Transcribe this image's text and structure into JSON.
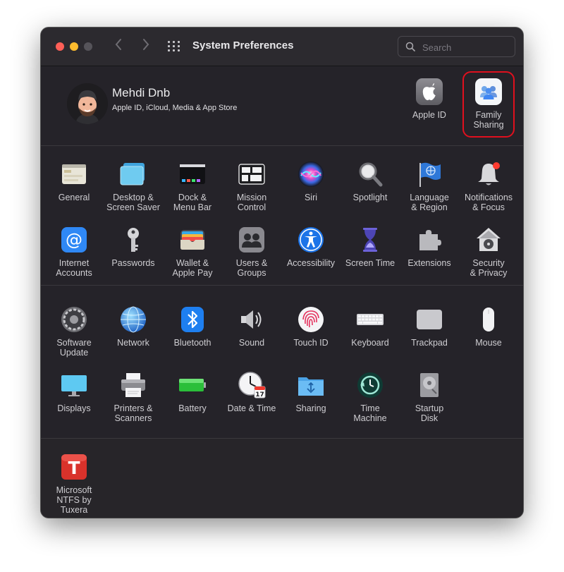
{
  "window": {
    "title": "System Preferences"
  },
  "search": {
    "placeholder": "Search"
  },
  "account": {
    "name": "Mehdi Dnb",
    "subtitle": "Apple ID, iCloud, Media & App Store",
    "items": [
      {
        "label": "Apple ID",
        "icon": "apple-logo-icon"
      },
      {
        "label": "Family\nSharing",
        "icon": "family-sharing-icon",
        "highlighted": true
      }
    ]
  },
  "section1": [
    {
      "label": "General",
      "icon": "general-icon"
    },
    {
      "label": "Desktop &\nScreen Saver",
      "icon": "desktop-icon"
    },
    {
      "label": "Dock &\nMenu Bar",
      "icon": "dock-icon"
    },
    {
      "label": "Mission\nControl",
      "icon": "mission-control-icon"
    },
    {
      "label": "Siri",
      "icon": "siri-icon"
    },
    {
      "label": "Spotlight",
      "icon": "spotlight-icon"
    },
    {
      "label": "Language\n& Region",
      "icon": "language-flag-icon"
    },
    {
      "label": "Notifications\n& Focus",
      "icon": "notifications-bell-icon"
    },
    {
      "label": "Internet\nAccounts",
      "icon": "at-sign-icon"
    },
    {
      "label": "Passwords",
      "icon": "key-icon"
    },
    {
      "label": "Wallet &\nApple Pay",
      "icon": "wallet-icon"
    },
    {
      "label": "Users &\nGroups",
      "icon": "users-icon"
    },
    {
      "label": "Accessibility",
      "icon": "accessibility-icon"
    },
    {
      "label": "Screen Time",
      "icon": "hourglass-icon"
    },
    {
      "label": "Extensions",
      "icon": "puzzle-icon"
    },
    {
      "label": "Security\n& Privacy",
      "icon": "house-lock-icon"
    }
  ],
  "section2": [
    {
      "label": "Software\nUpdate",
      "icon": "software-update-gear-icon"
    },
    {
      "label": "Network",
      "icon": "globe-icon"
    },
    {
      "label": "Bluetooth",
      "icon": "bluetooth-icon"
    },
    {
      "label": "Sound",
      "icon": "speaker-icon"
    },
    {
      "label": "Touch ID",
      "icon": "fingerprint-icon"
    },
    {
      "label": "Keyboard",
      "icon": "keyboard-icon"
    },
    {
      "label": "Trackpad",
      "icon": "trackpad-icon"
    },
    {
      "label": "Mouse",
      "icon": "mouse-icon"
    },
    {
      "label": "Displays",
      "icon": "display-icon"
    },
    {
      "label": "Printers &\nScanners",
      "icon": "printer-icon"
    },
    {
      "label": "Battery",
      "icon": "battery-icon"
    },
    {
      "label": "Date & Time",
      "icon": "clock-calendar-icon"
    },
    {
      "label": "Sharing",
      "icon": "sharing-folder-icon"
    },
    {
      "label": "Time\nMachine",
      "icon": "time-machine-icon"
    },
    {
      "label": "Startup\nDisk",
      "icon": "disk-icon"
    }
  ],
  "section3": [
    {
      "label": "Microsoft\nNTFS by Tuxera",
      "icon": "tuxera-t-icon"
    }
  ],
  "colors": {
    "window_bg": "#252329",
    "highlight_border": "#e0101e",
    "text": "#cfced2"
  }
}
